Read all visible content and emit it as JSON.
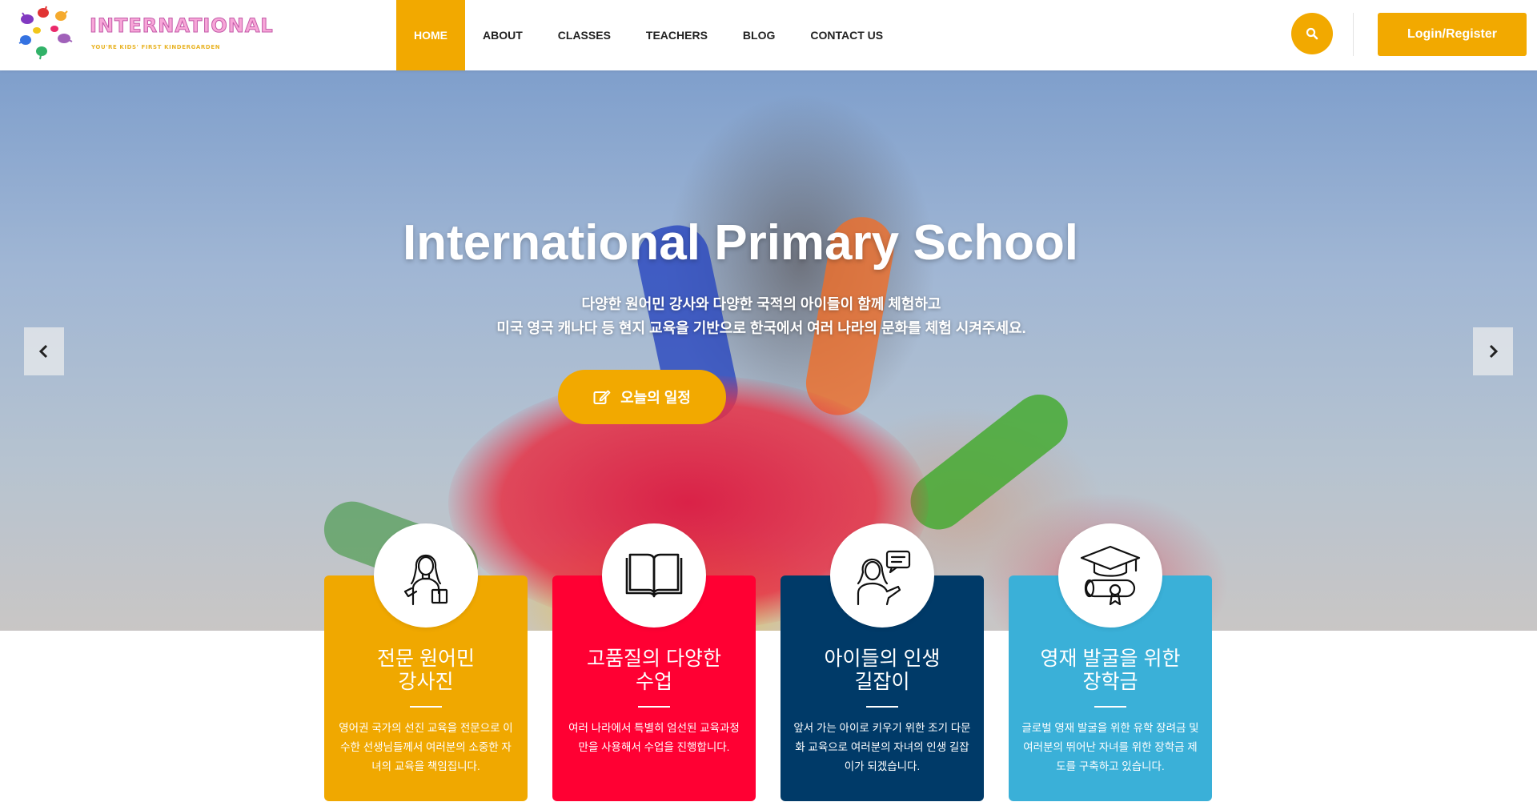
{
  "logo": {
    "title": "INTERNATIONAL",
    "tagline": "YOU'RE KIDS' FIRST KINDERGARDEN"
  },
  "nav": {
    "items": [
      {
        "label": "HOME",
        "active": true
      },
      {
        "label": "ABOUT",
        "active": false
      },
      {
        "label": "CLASSES",
        "active": false
      },
      {
        "label": "TEACHERS",
        "active": false
      },
      {
        "label": "BLOG",
        "active": false
      },
      {
        "label": "CONTACT US",
        "active": false
      }
    ]
  },
  "header": {
    "search_icon": "search-icon",
    "login_label": "Login/Register"
  },
  "hero": {
    "title": "International Primary School",
    "subtitle_line1": "다양한 원어민 강사와 다양한 국적의 아이들이 함께 체험하고",
    "subtitle_line2": "미국 영국 캐나다 등 현지 교육을 기반으로 한국에서 여러 나라의 문화를 체험 시켜주세요.",
    "cta_label": "오늘의 일정",
    "cta_icon": "edit-icon",
    "prev_icon": "chevron-left-icon",
    "next_icon": "chevron-right-icon"
  },
  "cards": [
    {
      "title_line1": "전문 원어민",
      "title_line2": "강사진",
      "text": "영어권 국가의 선진 교육을 전문으로 이수한 선생님들께서 여러분의 소중한 자녀의 교육을 책임집니다.",
      "icon": "teacher-icon",
      "color": "#f0a800"
    },
    {
      "title_line1": "고품질의 다양한",
      "title_line2": "수업",
      "text": "여러 나라에서 특별히 엄선된 교육과정만을 사용해서 수업을 진행합니다.",
      "icon": "open-book-icon",
      "color": "#ff0033"
    },
    {
      "title_line1": "아이들의 인생",
      "title_line2": "길잡이",
      "text": "앞서 가는 아이로 키우기 위한 조기 다문화 교육으로 여러분의 자녀의 인생 길잡이가 되겠습니다.",
      "icon": "mentor-chat-icon",
      "color": "#003a68"
    },
    {
      "title_line1": "영재 발굴을 위한",
      "title_line2": "장학금",
      "text": "글로벌 영재 발굴을 위한 유학 장려금 및 여러분의 뛰어난 자녀를 위한 장학금 제도를 구축하고 있습니다.",
      "icon": "graduation-cap-icon",
      "color": "#3ab0d8"
    }
  ],
  "colors": {
    "accent": "#f2a900"
  }
}
